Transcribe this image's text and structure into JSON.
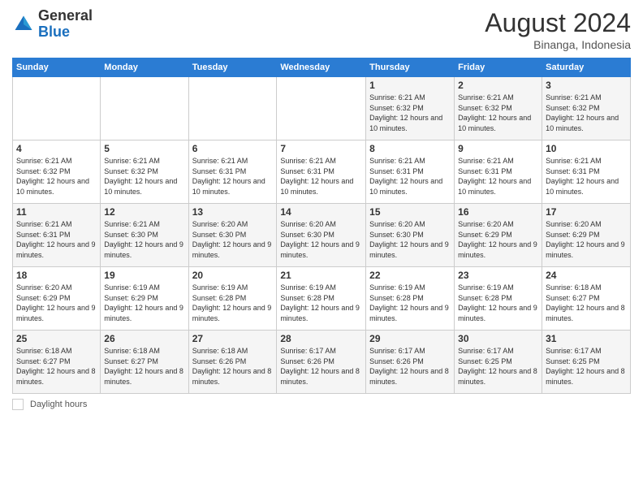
{
  "header": {
    "logo": {
      "general": "General",
      "blue": "Blue"
    },
    "month_year": "August 2024",
    "location": "Binanga, Indonesia"
  },
  "days_of_week": [
    "Sunday",
    "Monday",
    "Tuesday",
    "Wednesday",
    "Thursday",
    "Friday",
    "Saturday"
  ],
  "footer": {
    "label": "Daylight hours"
  },
  "weeks": [
    [
      {
        "day": "",
        "sunrise": "",
        "sunset": "",
        "daylight": ""
      },
      {
        "day": "",
        "sunrise": "",
        "sunset": "",
        "daylight": ""
      },
      {
        "day": "",
        "sunrise": "",
        "sunset": "",
        "daylight": ""
      },
      {
        "day": "",
        "sunrise": "",
        "sunset": "",
        "daylight": ""
      },
      {
        "day": "1",
        "sunrise": "Sunrise: 6:21 AM",
        "sunset": "Sunset: 6:32 PM",
        "daylight": "Daylight: 12 hours and 10 minutes."
      },
      {
        "day": "2",
        "sunrise": "Sunrise: 6:21 AM",
        "sunset": "Sunset: 6:32 PM",
        "daylight": "Daylight: 12 hours and 10 minutes."
      },
      {
        "day": "3",
        "sunrise": "Sunrise: 6:21 AM",
        "sunset": "Sunset: 6:32 PM",
        "daylight": "Daylight: 12 hours and 10 minutes."
      }
    ],
    [
      {
        "day": "4",
        "sunrise": "Sunrise: 6:21 AM",
        "sunset": "Sunset: 6:32 PM",
        "daylight": "Daylight: 12 hours and 10 minutes."
      },
      {
        "day": "5",
        "sunrise": "Sunrise: 6:21 AM",
        "sunset": "Sunset: 6:32 PM",
        "daylight": "Daylight: 12 hours and 10 minutes."
      },
      {
        "day": "6",
        "sunrise": "Sunrise: 6:21 AM",
        "sunset": "Sunset: 6:31 PM",
        "daylight": "Daylight: 12 hours and 10 minutes."
      },
      {
        "day": "7",
        "sunrise": "Sunrise: 6:21 AM",
        "sunset": "Sunset: 6:31 PM",
        "daylight": "Daylight: 12 hours and 10 minutes."
      },
      {
        "day": "8",
        "sunrise": "Sunrise: 6:21 AM",
        "sunset": "Sunset: 6:31 PM",
        "daylight": "Daylight: 12 hours and 10 minutes."
      },
      {
        "day": "9",
        "sunrise": "Sunrise: 6:21 AM",
        "sunset": "Sunset: 6:31 PM",
        "daylight": "Daylight: 12 hours and 10 minutes."
      },
      {
        "day": "10",
        "sunrise": "Sunrise: 6:21 AM",
        "sunset": "Sunset: 6:31 PM",
        "daylight": "Daylight: 12 hours and 10 minutes."
      }
    ],
    [
      {
        "day": "11",
        "sunrise": "Sunrise: 6:21 AM",
        "sunset": "Sunset: 6:31 PM",
        "daylight": "Daylight: 12 hours and 9 minutes."
      },
      {
        "day": "12",
        "sunrise": "Sunrise: 6:21 AM",
        "sunset": "Sunset: 6:30 PM",
        "daylight": "Daylight: 12 hours and 9 minutes."
      },
      {
        "day": "13",
        "sunrise": "Sunrise: 6:20 AM",
        "sunset": "Sunset: 6:30 PM",
        "daylight": "Daylight: 12 hours and 9 minutes."
      },
      {
        "day": "14",
        "sunrise": "Sunrise: 6:20 AM",
        "sunset": "Sunset: 6:30 PM",
        "daylight": "Daylight: 12 hours and 9 minutes."
      },
      {
        "day": "15",
        "sunrise": "Sunrise: 6:20 AM",
        "sunset": "Sunset: 6:30 PM",
        "daylight": "Daylight: 12 hours and 9 minutes."
      },
      {
        "day": "16",
        "sunrise": "Sunrise: 6:20 AM",
        "sunset": "Sunset: 6:29 PM",
        "daylight": "Daylight: 12 hours and 9 minutes."
      },
      {
        "day": "17",
        "sunrise": "Sunrise: 6:20 AM",
        "sunset": "Sunset: 6:29 PM",
        "daylight": "Daylight: 12 hours and 9 minutes."
      }
    ],
    [
      {
        "day": "18",
        "sunrise": "Sunrise: 6:20 AM",
        "sunset": "Sunset: 6:29 PM",
        "daylight": "Daylight: 12 hours and 9 minutes."
      },
      {
        "day": "19",
        "sunrise": "Sunrise: 6:19 AM",
        "sunset": "Sunset: 6:29 PM",
        "daylight": "Daylight: 12 hours and 9 minutes."
      },
      {
        "day": "20",
        "sunrise": "Sunrise: 6:19 AM",
        "sunset": "Sunset: 6:28 PM",
        "daylight": "Daylight: 12 hours and 9 minutes."
      },
      {
        "day": "21",
        "sunrise": "Sunrise: 6:19 AM",
        "sunset": "Sunset: 6:28 PM",
        "daylight": "Daylight: 12 hours and 9 minutes."
      },
      {
        "day": "22",
        "sunrise": "Sunrise: 6:19 AM",
        "sunset": "Sunset: 6:28 PM",
        "daylight": "Daylight: 12 hours and 9 minutes."
      },
      {
        "day": "23",
        "sunrise": "Sunrise: 6:19 AM",
        "sunset": "Sunset: 6:28 PM",
        "daylight": "Daylight: 12 hours and 9 minutes."
      },
      {
        "day": "24",
        "sunrise": "Sunrise: 6:18 AM",
        "sunset": "Sunset: 6:27 PM",
        "daylight": "Daylight: 12 hours and 8 minutes."
      }
    ],
    [
      {
        "day": "25",
        "sunrise": "Sunrise: 6:18 AM",
        "sunset": "Sunset: 6:27 PM",
        "daylight": "Daylight: 12 hours and 8 minutes."
      },
      {
        "day": "26",
        "sunrise": "Sunrise: 6:18 AM",
        "sunset": "Sunset: 6:27 PM",
        "daylight": "Daylight: 12 hours and 8 minutes."
      },
      {
        "day": "27",
        "sunrise": "Sunrise: 6:18 AM",
        "sunset": "Sunset: 6:26 PM",
        "daylight": "Daylight: 12 hours and 8 minutes."
      },
      {
        "day": "28",
        "sunrise": "Sunrise: 6:17 AM",
        "sunset": "Sunset: 6:26 PM",
        "daylight": "Daylight: 12 hours and 8 minutes."
      },
      {
        "day": "29",
        "sunrise": "Sunrise: 6:17 AM",
        "sunset": "Sunset: 6:26 PM",
        "daylight": "Daylight: 12 hours and 8 minutes."
      },
      {
        "day": "30",
        "sunrise": "Sunrise: 6:17 AM",
        "sunset": "Sunset: 6:25 PM",
        "daylight": "Daylight: 12 hours and 8 minutes."
      },
      {
        "day": "31",
        "sunrise": "Sunrise: 6:17 AM",
        "sunset": "Sunset: 6:25 PM",
        "daylight": "Daylight: 12 hours and 8 minutes."
      }
    ]
  ]
}
